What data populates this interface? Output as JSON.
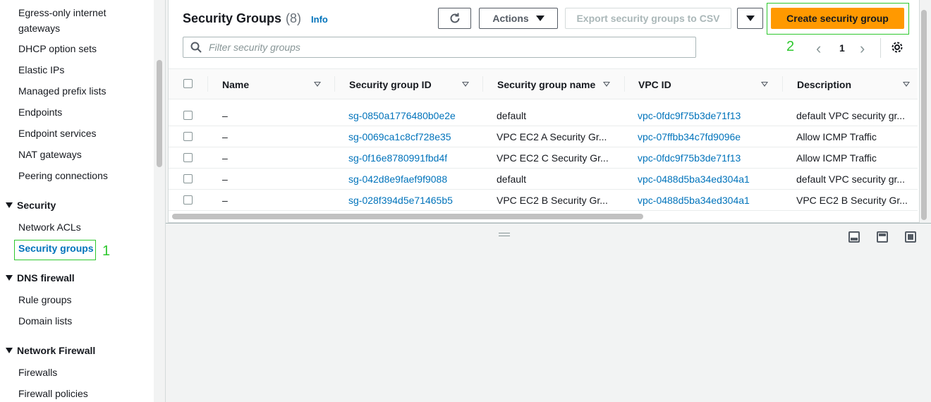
{
  "sidebar": {
    "items_top": [
      "Egress-only internet gateways",
      "DHCP option sets",
      "Elastic IPs",
      "Managed prefix lists",
      "Endpoints",
      "Endpoint services",
      "NAT gateways",
      "Peering connections"
    ],
    "sections": [
      {
        "title": "Security",
        "items": [
          "Network ACLs",
          "Security groups"
        ]
      },
      {
        "title": "DNS firewall",
        "items": [
          "Rule groups",
          "Domain lists"
        ]
      },
      {
        "title": "Network Firewall",
        "items": [
          "Firewalls",
          "Firewall policies"
        ]
      }
    ],
    "active_item": "Security groups",
    "marker_1": "1"
  },
  "header": {
    "title": "Security Groups",
    "count": "(8)",
    "info": "Info",
    "actions_label": "Actions",
    "export_label": "Export security groups to CSV",
    "create_label": "Create security group",
    "marker_2": "2"
  },
  "filter": {
    "placeholder": "Filter security groups"
  },
  "pagination": {
    "prev": "‹",
    "page": "1",
    "next": "›"
  },
  "table": {
    "columns": [
      "Name",
      "Security group ID",
      "Security group name",
      "VPC ID",
      "Description"
    ],
    "rows": [
      {
        "name": "–",
        "id": "sg-0850a1776480b0e2e",
        "group_name": "default",
        "vpc": "vpc-0fdc9f75b3de71f13",
        "desc": "default VPC security gr..."
      },
      {
        "name": "–",
        "id": "sg-0069ca1c8cf728e35",
        "group_name": "VPC EC2 A Security Gr...",
        "vpc": "vpc-07ffbb34c7fd9096e",
        "desc": "Allow ICMP Traffic"
      },
      {
        "name": "–",
        "id": "sg-0f16e8780991fbd4f",
        "group_name": "VPC EC2 C Security Gr...",
        "vpc": "vpc-0fdc9f75b3de71f13",
        "desc": "Allow ICMP Traffic"
      },
      {
        "name": "–",
        "id": "sg-042d8e9faef9f9088",
        "group_name": "default",
        "vpc": "vpc-0488d5ba34ed304a1",
        "desc": "default VPC security gr..."
      },
      {
        "name": "–",
        "id": "sg-028f394d5e71465b5",
        "group_name": "VPC EC2 B Security Gr...",
        "vpc": "vpc-0488d5ba34ed304a1",
        "desc": "VPC EC2 B Security Gr..."
      }
    ]
  },
  "colors": {
    "accent": "#ff9900",
    "link": "#0073bb",
    "highlight": "#2ec82e"
  }
}
